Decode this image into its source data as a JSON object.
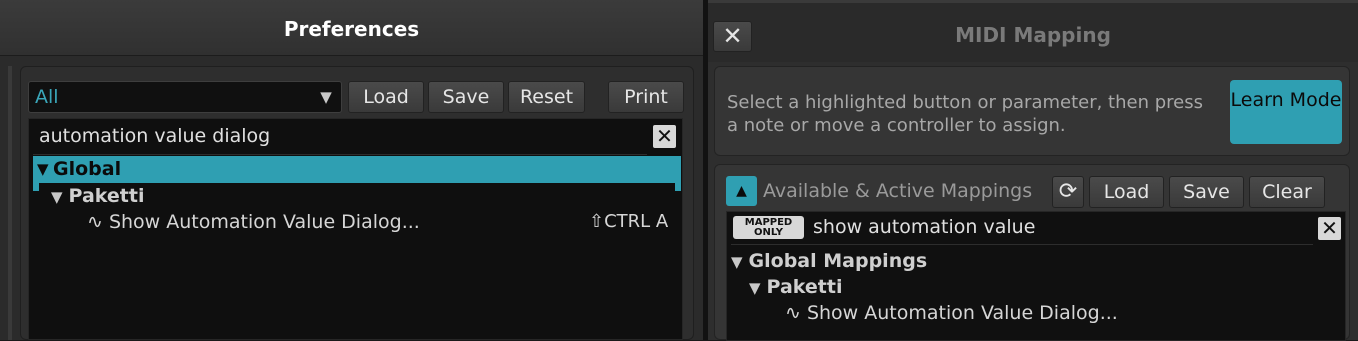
{
  "preferences": {
    "title": "Preferences",
    "category_value": "All",
    "buttons": {
      "load": "Load",
      "save": "Save",
      "reset": "Reset",
      "print": "Print"
    },
    "search_text": "automation value dialog",
    "tree": {
      "global_label": "Global",
      "paketti_label": "Paketti",
      "item_label": "∿ Show Automation Value Dialog...",
      "shortcut": "⇧CTRL A"
    }
  },
  "midi_mapping": {
    "title": "MIDI Mapping",
    "instruction": "Select a highlighted button or parameter, then press a note or move a controller to assign.",
    "learn_mode": "Learn Mode",
    "available_label": "Available & Active Mappings",
    "buttons": {
      "load": "Load",
      "save": "Save",
      "clear": "Clear"
    },
    "mapped_only_line1": "MAPPED",
    "mapped_only_line2": "ONLY",
    "search_text": "show automation value",
    "tree": {
      "global_label": "Global Mappings",
      "paketti_label": "Paketti",
      "item_label": "∿ Show Automation Value Dialog..."
    }
  },
  "icons": {
    "close": "close-icon",
    "dropdown": "chevron-down-icon",
    "clear_search": "clear-search-icon",
    "refresh": "refresh-icon",
    "collapse": "collapse-up-icon"
  },
  "colors": {
    "accent": "#2f9fb2",
    "link_text": "#3aa6b9"
  }
}
